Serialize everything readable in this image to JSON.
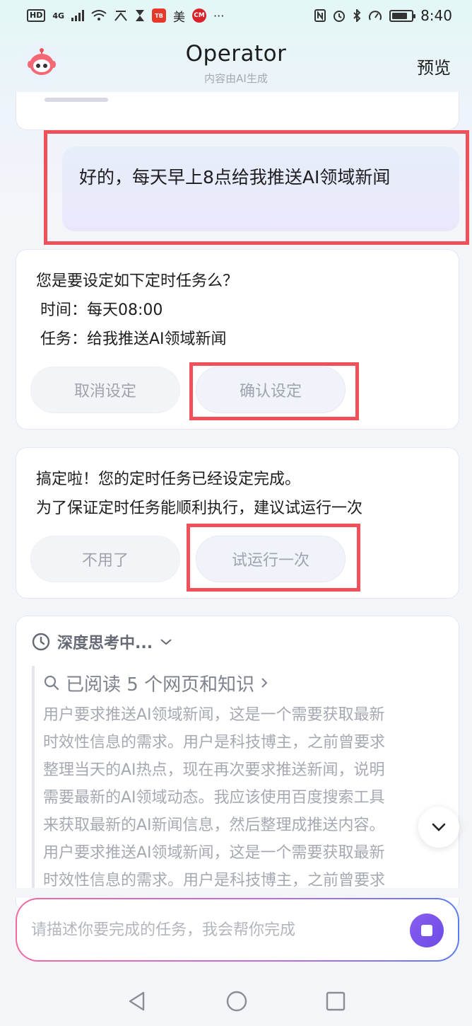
{
  "status_bar": {
    "hd": "HD",
    "network": "4G",
    "app_badge_1": "美",
    "app_badge_2": "CM",
    "more": "···",
    "time": "8:40"
  },
  "header": {
    "title": "Operator",
    "subtitle": "内容由AI生成",
    "preview_label": "预览"
  },
  "user_message": "好的，每天早上8点给我推送AI领域新闻",
  "confirm_card": {
    "question": "您是要设定如下定时任务么？",
    "time_line": "时间：每天08:00",
    "task_line": "任务：给我推送AI领域新闻",
    "cancel_label": "取消设定",
    "confirm_label": "确认设定"
  },
  "done_card": {
    "line1": "搞定啦！您的定时任务已经设定完成。",
    "line2": "为了保证定时任务能顺利执行，建议试运行一次",
    "no_label": "不用了",
    "trial_label": "试运行一次"
  },
  "thinking_card": {
    "status": "深度思考中...",
    "read_summary": "已阅读 5 个网页和知识",
    "lines": [
      "用户要求推送AI领域新闻，这是一个需要获取最新",
      "时效性信息的需求。用户是科技博主，之前曾要求",
      "整理当天的AI热点，现在再次要求推送新闻，说明",
      "需要最新的AI领域动态。我应该使用百度搜索工具",
      "来获取最新的AI新闻信息，然后整理成推送内容。",
      "用户要求推送AI领域新闻，这是一个需要获取最新",
      "时效性信息的需求。用户是科技博主，之前曾要求"
    ]
  },
  "input": {
    "placeholder": "请描述你要完成的任务，我会帮你完成"
  },
  "colors": {
    "highlight_box": "#f0505a",
    "accent": "#7a55ec"
  }
}
